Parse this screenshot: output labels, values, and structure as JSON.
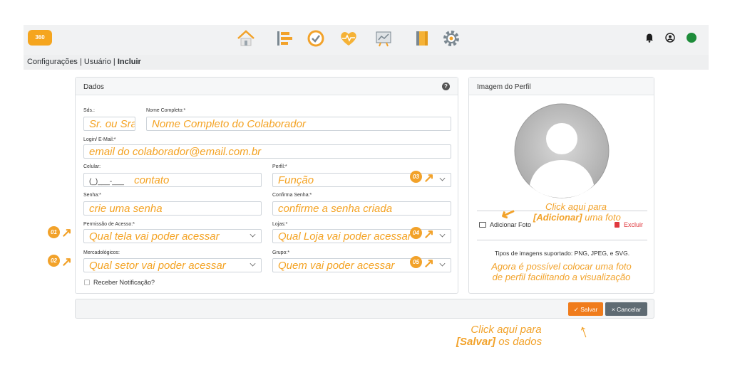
{
  "logo": {
    "text": "360"
  },
  "breadcrumb": {
    "part1": "Configurações",
    "sep1": " | ",
    "part2": "Usuário",
    "sep2": " | ",
    "current": "Incluir"
  },
  "dados": {
    "title": "Dados",
    "help": "?",
    "sds_label": "Sds.:",
    "sds_value": "Sr. ou Sra.",
    "nome_label": "Nome Completo:*",
    "nome_value": "Nome Completo do Colaborador",
    "login_label": "Login/ E-Mail:*",
    "login_value": "email do colaborador@email.com.br",
    "celular_label": "Celular:",
    "celular_mask": "(_)___-___",
    "celular_value": "contato",
    "perfil_label": "Perfil:*",
    "perfil_value": "Função",
    "senha_label": "Senha:*",
    "senha_value": "crie uma senha",
    "confirma_label": "Confirma Senha:*",
    "confirma_value": "confirme a senha criada",
    "permissao_label": "Permissão de Acesso:*",
    "permissao_value": "Qual tela vai poder acessar",
    "lojas_label": "Lojas:*",
    "lojas_value": "Qual Loja vai poder acessar",
    "mercado_label": "Mercadológicos:",
    "mercado_value": "Qual setor vai poder acessar",
    "grupo_label": "Grupo:*",
    "grupo_value": "Quem vai poder acessar",
    "notif_label": "Receber Notificação?"
  },
  "badges": {
    "b1": "01",
    "b2": "02",
    "b3": "03",
    "b4": "04",
    "b5": "05"
  },
  "perfil_card": {
    "title": "Imagem do Perfil",
    "add_photo": "Adicionar Foto",
    "delete": "Excluir",
    "types": "Tipos de imagens suportado: PNG, JPEG, e SVG."
  },
  "annotations": {
    "add_line1": "Click aqui para",
    "add_bold": "[Adicionar]",
    "add_line2": " uma foto",
    "info_line1": "Agora é possível colocar uma foto",
    "info_line2": "de perfil facilitando a visualização",
    "save_line1": "Click aqui para",
    "save_bold": "[Salvar]",
    "save_line2": " os dados"
  },
  "buttons": {
    "save": "Salvar",
    "cancel": "Cancelar"
  },
  "colors": {
    "accent": "#f2a22a",
    "save": "#f07c1c",
    "cancel": "#5f6b73",
    "status": "#1e8c3a"
  },
  "icons": [
    "home-icon",
    "list-icon",
    "check-circle-icon",
    "heart-pulse-icon",
    "chart-board-icon",
    "notebook-icon",
    "gear-icon",
    "bell-icon",
    "user-circle-icon"
  ]
}
